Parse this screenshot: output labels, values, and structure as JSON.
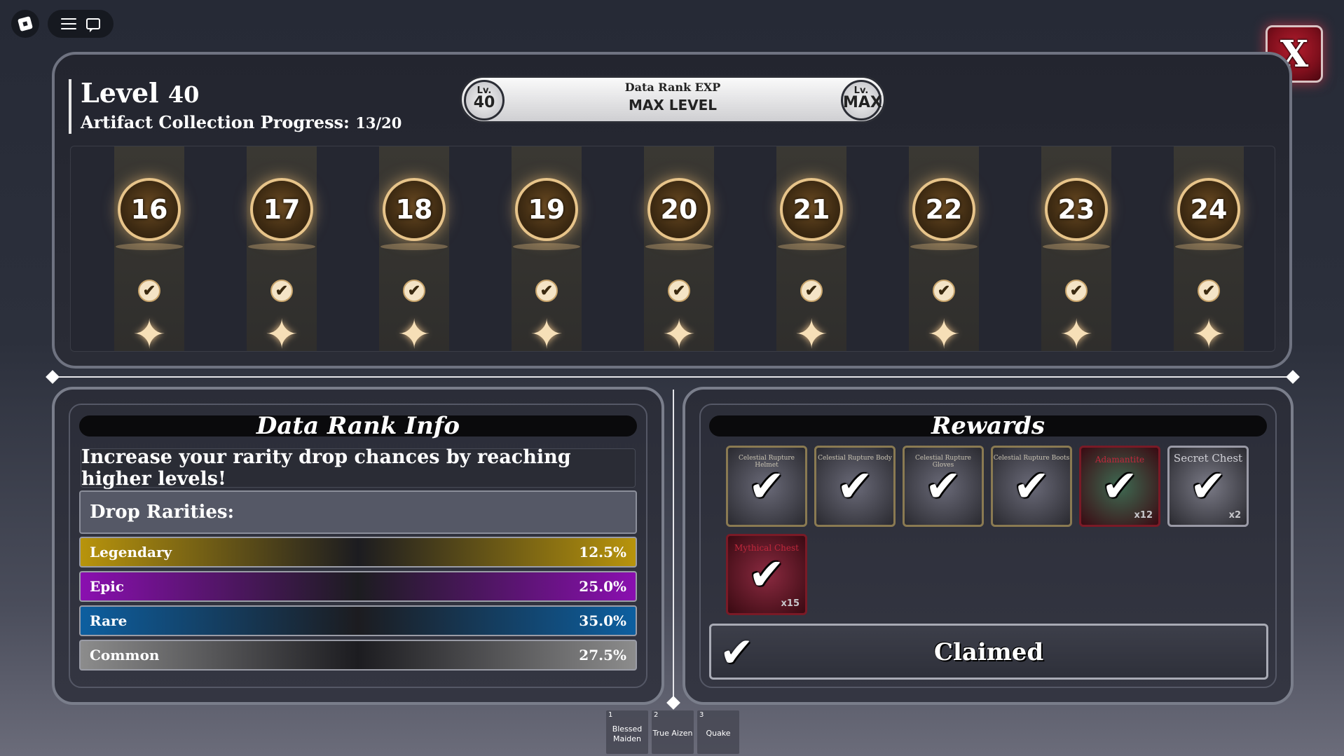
{
  "topbar": {
    "roblox_icon": "roblox-logo-icon",
    "menu_icon": "hamburger-icon",
    "chat_icon": "chat-icon"
  },
  "close_button": {
    "label": "X"
  },
  "level": {
    "title": "Level",
    "value": "40",
    "progress_label": "Artifact Collection Progress:",
    "progress_value": "13/20"
  },
  "exp_bar": {
    "title": "Data Rank EXP",
    "status": "MAX LEVEL",
    "left_prefix": "Lv.",
    "left_value": "40",
    "right_prefix": "Lv.",
    "right_value": "MAX",
    "progress": 1.0
  },
  "track": {
    "levels": [
      {
        "label": "16",
        "claimed": true
      },
      {
        "label": "17",
        "claimed": true
      },
      {
        "label": "18",
        "claimed": true
      },
      {
        "label": "19",
        "claimed": true
      },
      {
        "label": "20",
        "claimed": true
      },
      {
        "label": "21",
        "claimed": true
      },
      {
        "label": "22",
        "claimed": true
      },
      {
        "label": "23",
        "claimed": true
      },
      {
        "label": "24",
        "claimed": true
      }
    ],
    "check_glyph": "✔",
    "spark_glyph": "✦"
  },
  "info": {
    "title": "Data Rank Info",
    "description": "Increase your rarity drop chances by reaching higher levels!",
    "drop_header": "Drop Rarities:",
    "rarities": [
      {
        "name": "Legendary",
        "value": "12.5%",
        "color": "#b8940c"
      },
      {
        "name": "Epic",
        "value": "25.0%",
        "color": "#8a0fb0"
      },
      {
        "name": "Rare",
        "value": "35.0%",
        "color": "#0d5fa0"
      },
      {
        "name": "Common",
        "value": "27.5%",
        "color": "#8c8c8c"
      }
    ]
  },
  "rewards": {
    "title": "Rewards",
    "items": [
      {
        "name": "Celestial Rupture Helmet",
        "qty": "",
        "check": "✔"
      },
      {
        "name": "Celestial Rupture Body",
        "qty": "",
        "check": "✔"
      },
      {
        "name": "Celestial Rupture Gloves",
        "qty": "",
        "check": "✔"
      },
      {
        "name": "Celestial Rupture Boots",
        "qty": "",
        "check": "✔"
      },
      {
        "name": "Adamantite",
        "qty": "x12",
        "check": "✔"
      },
      {
        "name": "Secret Chest",
        "qty": "x2",
        "check": "✔"
      },
      {
        "name": "Mythical Chest",
        "qty": "x15",
        "check": "✔"
      }
    ],
    "claimed_label": "Claimed",
    "claimed_check": "✔"
  },
  "hotbar": [
    {
      "num": "1",
      "label": "Blessed Maiden"
    },
    {
      "num": "2",
      "label": "True Aizen"
    },
    {
      "num": "3",
      "label": "Quake"
    }
  ]
}
